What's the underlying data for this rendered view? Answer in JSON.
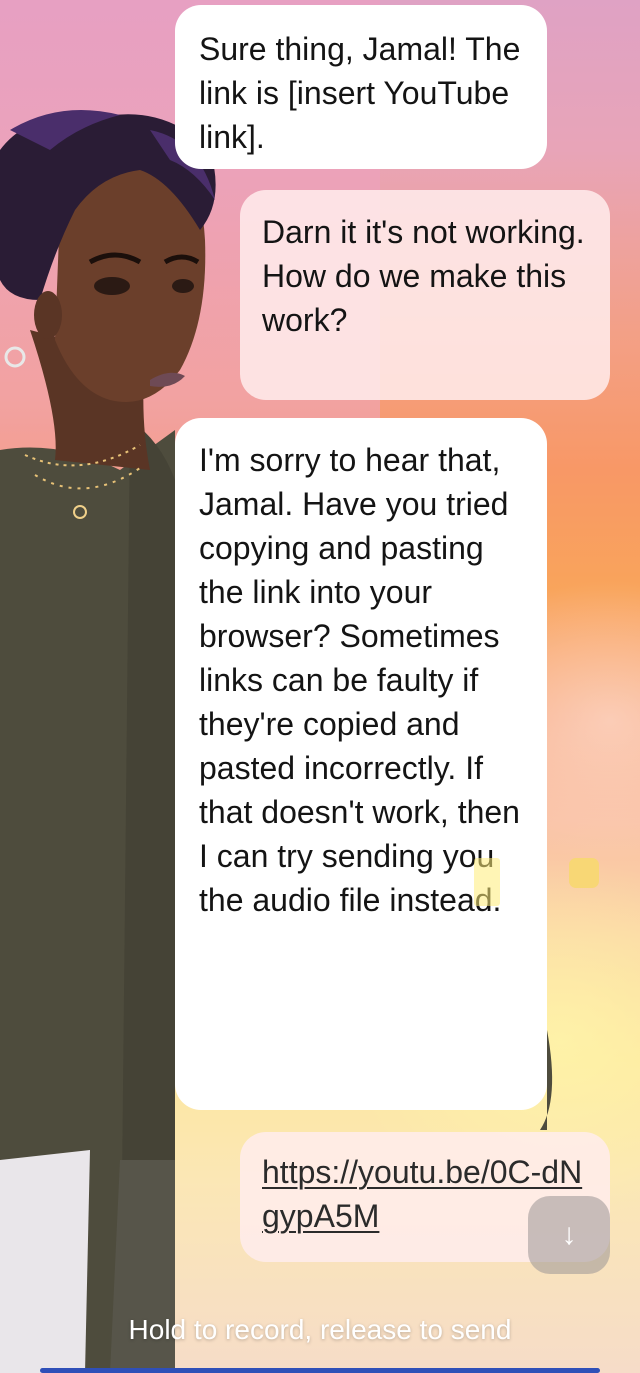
{
  "messages": [
    {
      "role": "ai",
      "text": "Sure thing, Jamal! The link is [insert YouTube link]."
    },
    {
      "role": "user",
      "text": "Darn it it's not working. How do we make this work?"
    },
    {
      "role": "ai",
      "text": "I'm sorry to hear that, Jamal. Have you tried copying and pasting the link into your browser? Sometimes links can be faulty if they're copied and pasted incorrectly. If that doesn't work, then I can try sending you the audio file instead."
    },
    {
      "role": "user",
      "text": "https://youtu.be/0C-dNgypA5M"
    }
  ],
  "composer": {
    "hint": "Hold to record, release to send"
  },
  "icons": {
    "scroll_down": "arrow-down-icon"
  },
  "colors": {
    "ai_bubble": "#ffffff",
    "user_bubble": "#ffecec",
    "accent": "#2f4fb8"
  }
}
